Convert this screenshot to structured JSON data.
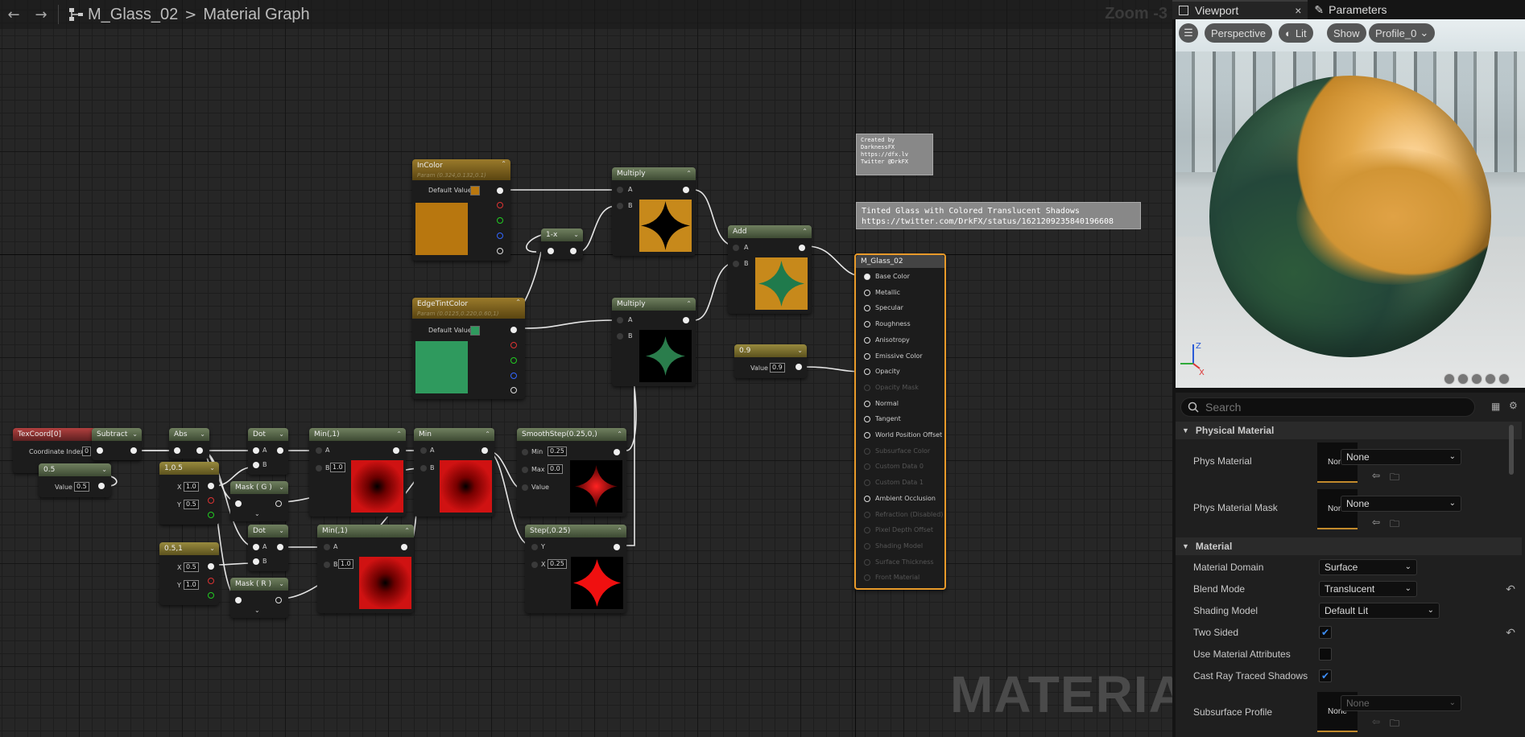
{
  "toolbar": {
    "asset_name": "M_Glass_02",
    "breadcrumb_sep": ">",
    "graph_name": "Material Graph",
    "zoom": "Zoom -3"
  },
  "watermark": "MATERIAL",
  "tabs": [
    {
      "label": "Viewport",
      "close": "×"
    },
    {
      "label": "Parameters"
    }
  ],
  "viewport": {
    "menu_icon": "hamburger-icon",
    "perspective": "Perspective",
    "lit": "Lit",
    "show": "Show",
    "profile": "Profile_0"
  },
  "nodes": {
    "incolor": {
      "title": "InColor",
      "subtitle": "Param (0.324,0.132,0.1)",
      "default_label": "Default Value",
      "color": "#b8770f"
    },
    "edgetint": {
      "title": "EdgeTintColor",
      "subtitle": "Param (0.0125,0.220,0.60,1)",
      "default_label": "Default Value",
      "color": "#2f9a5e"
    },
    "one_minus": {
      "title": "1-x"
    },
    "multiply1": {
      "title": "Multiply",
      "a": "A",
      "b": "B"
    },
    "multiply2": {
      "title": "Multiply",
      "a": "A",
      "b": "B"
    },
    "add": {
      "title": "Add",
      "a": "A",
      "b": "B"
    },
    "const09": {
      "title": "0.9",
      "value_label": "Value",
      "value": "0.9"
    },
    "texcoord": {
      "title": "TexCoord[0]",
      "coord_label": "Coordinate Index",
      "coord_value": "0"
    },
    "subtract": {
      "title": "Subtract"
    },
    "const05": {
      "title": "0.5",
      "value_label": "Value",
      "value": "0.5"
    },
    "abs": {
      "title": "Abs"
    },
    "vec_105": {
      "title": "1,0.5",
      "x_label": "X",
      "x": "1.0",
      "y_label": "Y",
      "y": "0.5"
    },
    "vec_051": {
      "title": "0.5,1",
      "x_label": "X",
      "x": "0.5",
      "y_label": "Y",
      "y": "1.0"
    },
    "dot1": {
      "title": "Dot",
      "a": "A",
      "b": "B"
    },
    "dot2": {
      "title": "Dot",
      "a": "A",
      "b": "B"
    },
    "mask_g": {
      "title": "Mask ( G )"
    },
    "mask_r": {
      "title": "Mask ( R )"
    },
    "min1": {
      "title": "Min(,1)",
      "a": "A",
      "b": "B",
      "b_value": "1.0"
    },
    "min2": {
      "title": "Min",
      "a": "A",
      "b": "B"
    },
    "min3": {
      "title": "Min(,1)",
      "a": "A",
      "b": "B",
      "b_value": "1.0"
    },
    "smoothstep": {
      "title": "SmoothStep(0.25,0,)",
      "min_label": "Min",
      "min": "0.25",
      "max_label": "Max",
      "max": "0.0",
      "value_label": "Value"
    },
    "step": {
      "title": "Step(,0.25)",
      "y_label": "Y",
      "x_label": "X",
      "x": "0.25"
    },
    "result": {
      "title": "M_Glass_02",
      "pins": [
        {
          "label": "Base Color",
          "active": true
        },
        {
          "label": "Metallic",
          "active": true
        },
        {
          "label": "Specular",
          "active": true
        },
        {
          "label": "Roughness",
          "active": true
        },
        {
          "label": "Anisotropy",
          "active": true
        },
        {
          "label": "Emissive Color",
          "active": true
        },
        {
          "label": "Opacity",
          "active": true
        },
        {
          "label": "Opacity Mask",
          "active": false
        },
        {
          "label": "Normal",
          "active": true
        },
        {
          "label": "Tangent",
          "active": true
        },
        {
          "label": "World Position Offset",
          "active": true
        },
        {
          "label": "Subsurface Color",
          "active": false
        },
        {
          "label": "Custom Data 0",
          "active": false
        },
        {
          "label": "Custom Data 1",
          "active": false
        },
        {
          "label": "Ambient Occlusion",
          "active": true
        },
        {
          "label": "Refraction (Disabled)",
          "active": false
        },
        {
          "label": "Pixel Depth Offset",
          "active": false
        },
        {
          "label": "Shading Model",
          "active": false
        },
        {
          "label": "Surface Thickness",
          "active": false
        },
        {
          "label": "Front Material",
          "active": false
        }
      ]
    }
  },
  "comments": {
    "credit": "Created by\nDarknessFX\nhttps://dfx.lv\nTwitter @DrkFX",
    "title": "Tinted Glass with Colored Translucent Shadows\nhttps://twitter.com/DrkFX/status/1621209235840196608"
  },
  "details": {
    "search_placeholder": "Search",
    "physical_material_header": "Physical Material",
    "phys_material_label": "Phys Material",
    "phys_material_thumb": "None",
    "phys_material_value": "None",
    "phys_mask_label": "Phys Material Mask",
    "phys_mask_thumb": "None",
    "phys_mask_value": "None",
    "material_header": "Material",
    "domain_label": "Material Domain",
    "domain_value": "Surface",
    "blend_label": "Blend Mode",
    "blend_value": "Translucent",
    "shading_label": "Shading Model",
    "shading_value": "Default Lit",
    "two_sided_label": "Two Sided",
    "two_sided": true,
    "use_attr_label": "Use Material Attributes",
    "use_attr": false,
    "cast_rt_label": "Cast Ray Traced Shadows",
    "cast_rt": true,
    "subsurface_label": "Subsurface Profile",
    "subsurface_thumb": "None",
    "subsurface_value": "None"
  }
}
